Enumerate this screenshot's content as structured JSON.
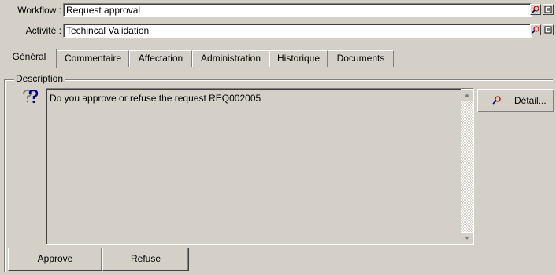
{
  "workflow": {
    "label": "Workflow :",
    "value": "Request approval"
  },
  "activite": {
    "label": "Activité :",
    "value": "Techincal Validation"
  },
  "tabs": [
    {
      "label": "Général",
      "active": true
    },
    {
      "label": "Commentaire",
      "active": false
    },
    {
      "label": "Affectation",
      "active": false
    },
    {
      "label": "Administration",
      "active": false
    },
    {
      "label": "Historique",
      "active": false
    },
    {
      "label": "Documents",
      "active": false
    }
  ],
  "description": {
    "legend": "Description",
    "text": "Do you approve or refuse the request REQ002005",
    "icon": "question-icon"
  },
  "buttons": {
    "detail": "Détail...",
    "approve": "Approve",
    "refuse": "Refuse"
  },
  "icons": {
    "zoom": "magnifier-icon",
    "open": "open-record-icon",
    "scroll_up": "scroll-up-arrow-icon",
    "scroll_down": "scroll-down-arrow-icon"
  },
  "colors": {
    "face": "#d4d0c8",
    "field_bg": "#ffffff",
    "shadow": "#808080",
    "icon_blue": "#000080",
    "icon_red": "#c00000"
  }
}
